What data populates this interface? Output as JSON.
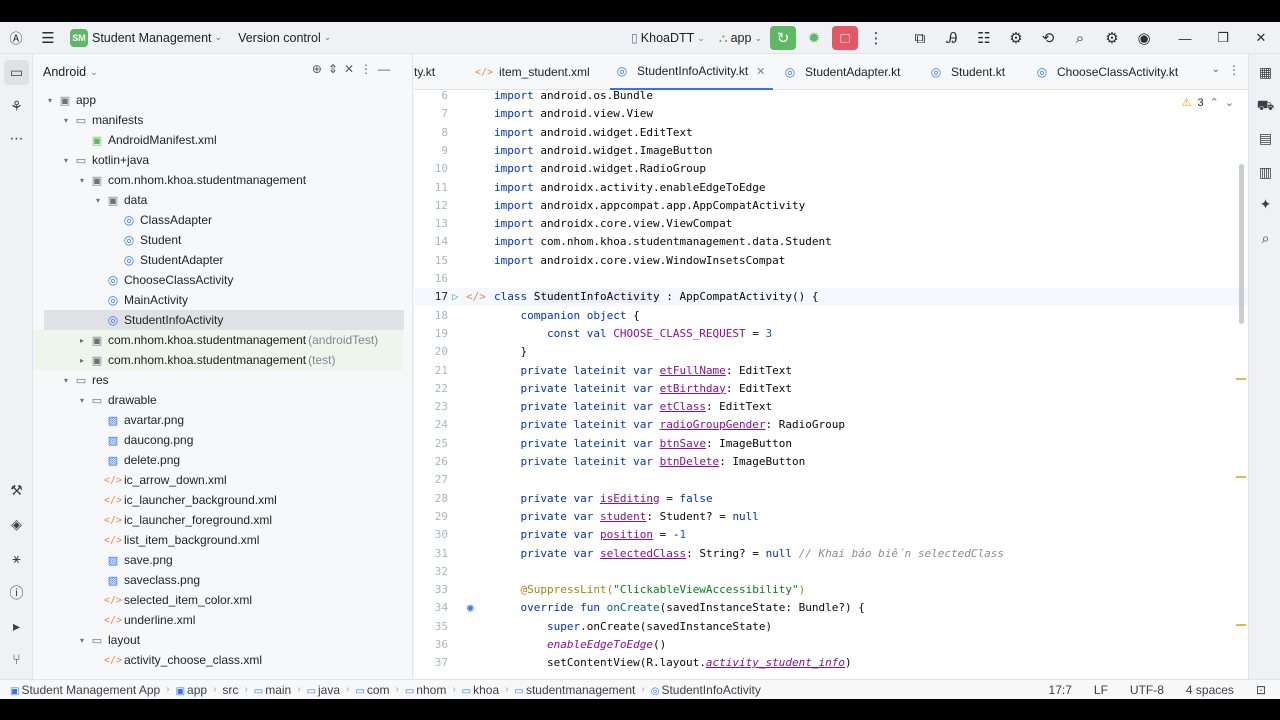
{
  "titlebar": {
    "project_badge": "SM",
    "project_name": "Student Management",
    "vcs": "Version control",
    "account": "KhoaDTT",
    "run_config": "app"
  },
  "project_panel": {
    "view": "Android",
    "tree": [
      {
        "label": "app",
        "suffix": "",
        "depth": 0,
        "icon": "folder-module-icon",
        "arrow": "down"
      },
      {
        "label": "manifests",
        "suffix": "",
        "depth": 1,
        "icon": "folder-icon",
        "arrow": "down"
      },
      {
        "label": "AndroidManifest.xml",
        "suffix": "",
        "depth": 2,
        "icon": "manifest-icon",
        "arrow": ""
      },
      {
        "label": "kotlin+java",
        "suffix": "",
        "depth": 1,
        "icon": "folder-icon",
        "arrow": "down"
      },
      {
        "label": "com.nhom.khoa.studentmanagement",
        "suffix": "",
        "depth": 2,
        "icon": "package-icon",
        "arrow": "down"
      },
      {
        "label": "data",
        "suffix": "",
        "depth": 3,
        "icon": "package-icon",
        "arrow": "down"
      },
      {
        "label": "ClassAdapter",
        "suffix": "",
        "depth": 4,
        "icon": "class-icon",
        "arrow": ""
      },
      {
        "label": "Student",
        "suffix": "",
        "depth": 4,
        "icon": "class-icon",
        "arrow": ""
      },
      {
        "label": "StudentAdapter",
        "suffix": "",
        "depth": 4,
        "icon": "class-icon",
        "arrow": ""
      },
      {
        "label": "ChooseClassActivity",
        "suffix": "",
        "depth": 3,
        "icon": "class-icon",
        "arrow": ""
      },
      {
        "label": "MainActivity",
        "suffix": "",
        "depth": 3,
        "icon": "class-icon",
        "arrow": ""
      },
      {
        "label": "StudentInfoActivity",
        "suffix": "",
        "depth": 3,
        "icon": "class-icon",
        "arrow": "",
        "selected": true
      },
      {
        "label": "com.nhom.khoa.studentmanagement",
        "suffix": "(androidTest)",
        "depth": 2,
        "icon": "package-icon",
        "arrow": "right",
        "green": true
      },
      {
        "label": "com.nhom.khoa.studentmanagement",
        "suffix": "(test)",
        "depth": 2,
        "icon": "package-icon",
        "arrow": "right",
        "green": true
      },
      {
        "label": "res",
        "suffix": "",
        "depth": 1,
        "icon": "folder-icon",
        "arrow": "down"
      },
      {
        "label": "drawable",
        "suffix": "",
        "depth": 2,
        "icon": "folder-icon",
        "arrow": "down"
      },
      {
        "label": "avartar.png",
        "suffix": "",
        "depth": 3,
        "icon": "image-icon",
        "arrow": ""
      },
      {
        "label": "daucong.png",
        "suffix": "",
        "depth": 3,
        "icon": "image-icon",
        "arrow": ""
      },
      {
        "label": "delete.png",
        "suffix": "",
        "depth": 3,
        "icon": "image-icon",
        "arrow": ""
      },
      {
        "label": "ic_arrow_down.xml",
        "suffix": "",
        "depth": 3,
        "icon": "xml-icon",
        "arrow": ""
      },
      {
        "label": "ic_launcher_background.xml",
        "suffix": "",
        "depth": 3,
        "icon": "xml-icon",
        "arrow": ""
      },
      {
        "label": "ic_launcher_foreground.xml",
        "suffix": "",
        "depth": 3,
        "icon": "xml-icon",
        "arrow": ""
      },
      {
        "label": "list_item_background.xml",
        "suffix": "",
        "depth": 3,
        "icon": "xml-icon",
        "arrow": ""
      },
      {
        "label": "save.png",
        "suffix": "",
        "depth": 3,
        "icon": "image-icon",
        "arrow": ""
      },
      {
        "label": "saveclass.png",
        "suffix": "",
        "depth": 3,
        "icon": "image-icon",
        "arrow": ""
      },
      {
        "label": "selected_item_color.xml",
        "suffix": "",
        "depth": 3,
        "icon": "xml-icon",
        "arrow": ""
      },
      {
        "label": "underline.xml",
        "suffix": "",
        "depth": 3,
        "icon": "xml-icon",
        "arrow": ""
      },
      {
        "label": "layout",
        "suffix": "",
        "depth": 2,
        "icon": "folder-icon",
        "arrow": "down"
      },
      {
        "label": "activity_choose_class.xml",
        "suffix": "",
        "depth": 3,
        "icon": "xml-icon",
        "arrow": ""
      }
    ]
  },
  "tabs": [
    {
      "label": "ty.kt",
      "icon": "",
      "active": false
    },
    {
      "label": "item_student.xml",
      "icon": "xml-icon",
      "active": false
    },
    {
      "label": "StudentInfoActivity.kt",
      "icon": "class-icon",
      "active": true
    },
    {
      "label": "StudentAdapter.kt",
      "icon": "class-icon",
      "active": false
    },
    {
      "label": "Student.kt",
      "icon": "class-icon",
      "active": false
    },
    {
      "label": "ChooseClassActivity.kt",
      "icon": "class-icon",
      "active": false
    }
  ],
  "editor": {
    "warnings_count": "3",
    "current_line": 17,
    "lines": [
      {
        "n": 6,
        "html": "<span class='k'>import</span> android.os.Bundle"
      },
      {
        "n": 7,
        "html": "<span class='k'>import</span> android.view.View"
      },
      {
        "n": 8,
        "html": "<span class='k'>import</span> android.widget.EditText"
      },
      {
        "n": 9,
        "html": "<span class='k'>import</span> android.widget.ImageButton"
      },
      {
        "n": 10,
        "html": "<span class='k'>import</span> android.widget.RadioGroup"
      },
      {
        "n": 11,
        "html": "<span class='k'>import</span> androidx.activity.enableEdgeToEdge"
      },
      {
        "n": 12,
        "html": "<span class='k'>import</span> androidx.appcompat.app.AppCompatActivity"
      },
      {
        "n": 13,
        "html": "<span class='k'>import</span> androidx.core.view.ViewCompat"
      },
      {
        "n": 14,
        "html": "<span class='k'>import</span> com.nhom.khoa.studentmanagement.data.Student"
      },
      {
        "n": 15,
        "html": "<span class='k'>import</span> androidx.core.view.WindowInsetsCompat"
      },
      {
        "n": 16,
        "html": ""
      },
      {
        "n": 17,
        "html": "<span class='k'>class</span> <span class='hl'>StudentInfoActivity</span> : AppCompatActivity() {"
      },
      {
        "n": 18,
        "html": "    <span class='k'>companion object</span> {"
      },
      {
        "n": 19,
        "html": "        <span class='k'>const val</span> <span class='p'>CHOOSE_CLASS_REQUEST</span> = <span class='n'>3</span>"
      },
      {
        "n": 20,
        "html": "    }"
      },
      {
        "n": 21,
        "html": "    <span class='k'>private lateinit var</span> <span class='p u'>etFullName</span>: EditText"
      },
      {
        "n": 22,
        "html": "    <span class='k'>private lateinit var</span> <span class='p u'>etBirthday</span>: EditText"
      },
      {
        "n": 23,
        "html": "    <span class='k'>private lateinit var</span> <span class='p u'>etClass</span>: EditText"
      },
      {
        "n": 24,
        "html": "    <span class='k'>private lateinit var</span> <span class='p u'>radioGroupGender</span>: RadioGroup"
      },
      {
        "n": 25,
        "html": "    <span class='k'>private lateinit var</span> <span class='p u'>btnSave</span>: ImageButton"
      },
      {
        "n": 26,
        "html": "    <span class='k'>private lateinit var</span> <span class='p u'>btnDelete</span>: ImageButton"
      },
      {
        "n": 27,
        "html": ""
      },
      {
        "n": 28,
        "html": "    <span class='k'>private var</span> <span class='p u'>isEditing</span> = <span class='k'>false</span>"
      },
      {
        "n": 29,
        "html": "    <span class='k'>private var</span> <span class='p u'>student</span>: Student? = <span class='k'>null</span>"
      },
      {
        "n": 30,
        "html": "    <span class='k'>private var</span> <span class='p u'>position</span> = -<span class='n'>1</span>"
      },
      {
        "n": 31,
        "html": "    <span class='k'>private var</span> <span class='p u'>selectedClass</span>: String? = <span class='k'>null</span> <span class='c'>// Khai báo biến selectedClass</span>"
      },
      {
        "n": 32,
        "html": ""
      },
      {
        "n": 33,
        "html": "    <span class='a'>@SuppressLint(</span><span class='s'>\"ClickableViewAccessibility\"</span><span class='a'>)</span>"
      },
      {
        "n": 34,
        "html": "    <span class='k'>override fun</span> <span class='f'>onCreate</span>(savedInstanceState: Bundle?) {"
      },
      {
        "n": 35,
        "html": "        <span class='k'>super</span>.onCreate(savedInstanceState)"
      },
      {
        "n": 36,
        "html": "        <span class='it'>enableEdgeToEdge</span>()"
      },
      {
        "n": 37,
        "html": "        setContentView(R.layout.<span class='it u'>activity_student_info</span>)"
      }
    ]
  },
  "status": {
    "crumbs": [
      "Student Management App",
      "app",
      "src",
      "main",
      "java",
      "com",
      "nhom",
      "khoa",
      "studentmanagement",
      "StudentInfoActivity"
    ],
    "position": "17:7",
    "line_sep": "LF",
    "encoding": "UTF-8",
    "indent": "4 spaces"
  }
}
